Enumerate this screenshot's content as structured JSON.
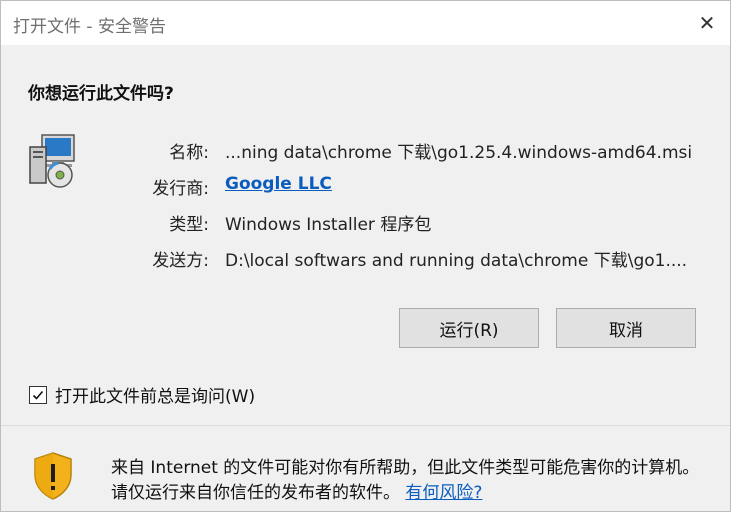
{
  "window": {
    "title": "打开文件 - 安全警告",
    "close_glyph": "✕"
  },
  "dialog": {
    "question": "你想运行此文件吗?",
    "fields": {
      "name_label": "名称:",
      "name_value": "...ning data\\chrome 下载\\go1.25.4.windows-amd64.msi",
      "publisher_label": "发行商:",
      "publisher_value": "Google LLC",
      "type_label": "类型:",
      "type_value": "Windows Installer 程序包",
      "from_label": "发送方:",
      "from_value": "D:\\local softwars and running data\\chrome 下载\\go1...."
    },
    "run_button": "运行(R)",
    "cancel_button": "取消",
    "always_ask_label": "打开此文件前总是询问(W)",
    "always_ask_checked": true
  },
  "warning": {
    "text": "来自 Internet 的文件可能对你有所帮助，但此文件类型可能危害你的计算机。请仅运行来自你信任的发布者的软件。",
    "link": "有何风险?"
  },
  "colors": {
    "link": "#0b5cbf",
    "dialog_bg": "#f0f0f0",
    "button_bg": "#e1e1e1",
    "shield_yellow": "#f3b21b"
  },
  "icons": {
    "program": "installer-program-icon",
    "shield": "security-shield-warning-icon",
    "close": "close-icon",
    "checkbox": "checkmark-icon"
  }
}
